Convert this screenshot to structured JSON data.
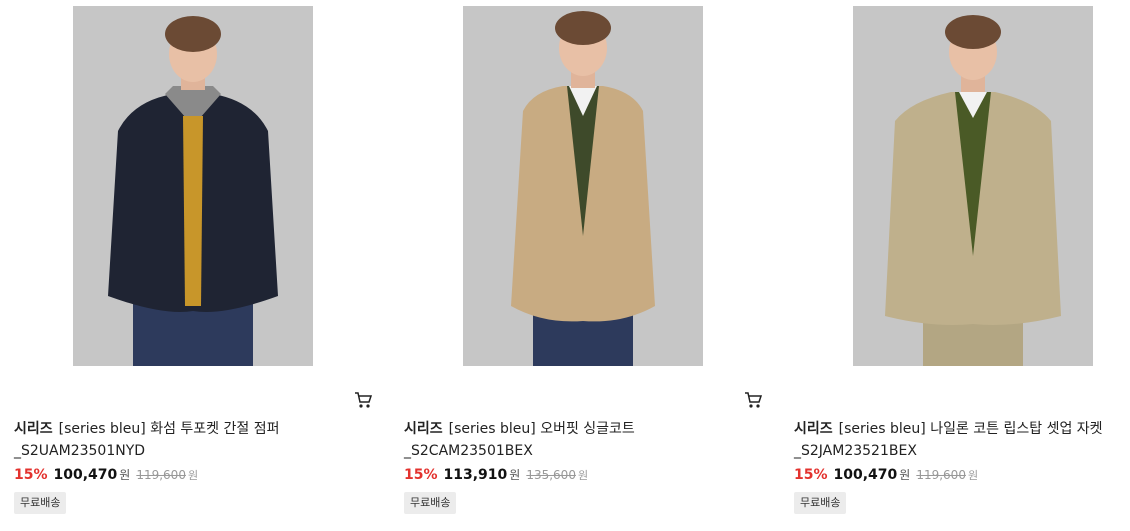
{
  "products": [
    {
      "brand": "시리즈",
      "name": "[series bleu] 화섬 투포켓 간절 점퍼",
      "code": "_S2UAM23501NYD",
      "discount": "15%",
      "price": "100,470",
      "currency": "원",
      "original_price": "119,600",
      "badge": "무료배송",
      "image_icon": "model-navy-jumper-photo"
    },
    {
      "brand": "시리즈",
      "name": "[series bleu] 오버핏 싱글코트",
      "code": "_S2CAM23501BEX",
      "discount": "15%",
      "price": "113,910",
      "currency": "원",
      "original_price": "135,600",
      "badge": "무료배송",
      "image_icon": "model-beige-coat-photo"
    },
    {
      "brand": "시리즈",
      "name": "[series bleu] 나일론 코튼 립스탑 셋업 자켓",
      "code": "_S2JAM23521BEX",
      "discount": "15%",
      "price": "100,470",
      "currency": "원",
      "original_price": "119,600",
      "badge": "무료배송",
      "image_icon": "model-khaki-jacket-photo"
    }
  ],
  "colors": {
    "discount": "#e3322e",
    "badge_bg": "#ececec",
    "photo_bg": "#c6c6c6"
  },
  "cart_icon": "cart-icon"
}
